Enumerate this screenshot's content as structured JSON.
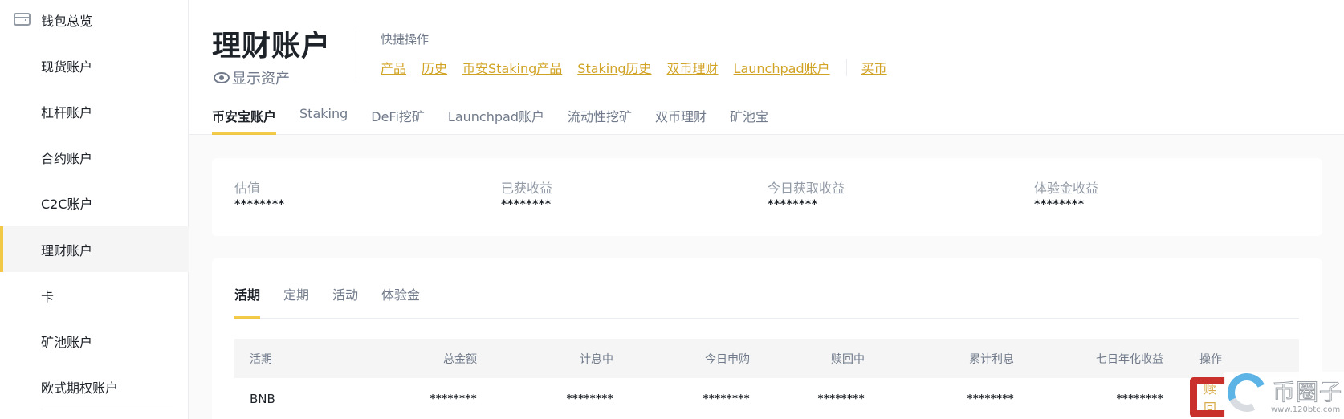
{
  "sidebar": {
    "items": [
      {
        "label": "钱包总览",
        "icon": "wallet-icon",
        "active": false
      },
      {
        "label": "现货账户",
        "active": false
      },
      {
        "label": "杠杆账户",
        "active": false
      },
      {
        "label": "合约账户",
        "active": false
      },
      {
        "label": "C2C账户",
        "active": false
      },
      {
        "label": "理财账户",
        "active": true
      },
      {
        "label": "卡",
        "active": false
      },
      {
        "label": "矿池账户",
        "active": false
      },
      {
        "label": "欧式期权账户",
        "active": false
      }
    ]
  },
  "header": {
    "title": "理财账户",
    "show_assets": "显示资产",
    "quick_actions_label": "快捷操作",
    "quick_links": [
      "产品",
      "历史",
      "币安Staking产品",
      "Staking历史",
      "双币理财",
      "Launchpad账户"
    ],
    "quick_links_extra": [
      "买币"
    ],
    "tabs": [
      {
        "label": "币安宝账户",
        "active": true
      },
      {
        "label": "Staking",
        "active": false
      },
      {
        "label": "DeFi挖矿",
        "active": false
      },
      {
        "label": "Launchpad账户",
        "active": false
      },
      {
        "label": "流动性挖矿",
        "active": false
      },
      {
        "label": "双币理财",
        "active": false
      },
      {
        "label": "矿池宝",
        "active": false
      }
    ]
  },
  "summary": [
    {
      "label": "估值",
      "value": "********"
    },
    {
      "label": "已获收益",
      "value": "********"
    },
    {
      "label": "今日获取收益",
      "value": "********"
    },
    {
      "label": "体验金收益",
      "value": "********"
    }
  ],
  "detail": {
    "sub_tabs": [
      {
        "label": "活期",
        "active": true
      },
      {
        "label": "定期",
        "active": false
      },
      {
        "label": "活动",
        "active": false
      },
      {
        "label": "体验金",
        "active": false
      }
    ],
    "table": {
      "columns": [
        "活期",
        "总金额",
        "计息中",
        "今日申购",
        "赎回中",
        "累计利息",
        "七日年化收益",
        "操作"
      ],
      "rows": [
        {
          "asset": "BNB",
          "total": "********",
          "earning": "********",
          "today_purchase": "********",
          "redeeming": "********",
          "cumulative_interest": "********",
          "seven_day_apy": "********",
          "action": "赎回"
        }
      ]
    }
  },
  "watermark": {
    "text": "币圈子",
    "url": "www.120btc.com"
  },
  "colors": {
    "accent": "#f0b90b",
    "link": "#c99400",
    "highlight_box": "#c9302c"
  }
}
